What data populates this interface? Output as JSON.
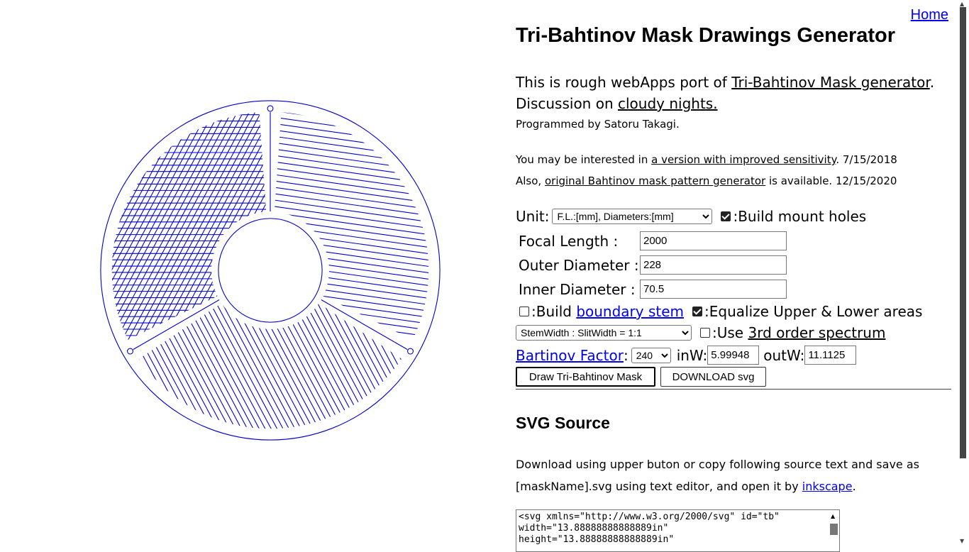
{
  "nav": {
    "home": "Home"
  },
  "title": "Tri-Bahtinov Mask Drawings Generator",
  "intro": {
    "line1_prefix": "This is rough webApps port of ",
    "line1_link": "Tri-Bahtinov Mask generator",
    "line1_suffix": ".",
    "line2_prefix": "Discussion on ",
    "line2_link": "cloudy nights."
  },
  "author": "Programmed by Satoru Takagi.",
  "notes": [
    {
      "prefix": "You may be interested in ",
      "link": "a version with improved sensitivity",
      "suffix": ". 7/15/2018"
    },
    {
      "prefix": "Also, ",
      "link": "original Bahtinov mask pattern generator",
      "suffix": " is available. 12/15/2020"
    }
  ],
  "form": {
    "unit_label": "Unit:",
    "unit_selected": "F.L.:[mm], Diameters:[mm]",
    "mount_holes_label": ":Build mount holes",
    "mount_holes_checked": true,
    "focal_length_label": "Focal Length :",
    "focal_length_value": "2000",
    "outer_diameter_label": "Outer Diameter :",
    "outer_diameter_value": "228",
    "inner_diameter_label": "Inner Diameter :",
    "inner_diameter_value": "70.5",
    "boundary_prefix": ":Build ",
    "boundary_link": "boundary stem",
    "boundary_checked": false,
    "equalize_label": ":Equalize Upper & Lower areas",
    "equalize_checked": true,
    "stem_ratio_selected": "StemWidth : SlitWidth = 1:1",
    "third_order_prefix": ":Use ",
    "third_order_link": "3rd order spectrum",
    "third_order_checked": false,
    "bahtinov_factor_link": "Bartinov Factor",
    "bahtinov_factor_colon": ":",
    "bahtinov_factor_selected": "240",
    "inw_label": "inW:",
    "inw_value": "5.99948",
    "outw_label": "outW:",
    "outw_value": "11.1125",
    "draw_button": "Draw Tri-Bahtinov Mask",
    "download_button": "DOWNLOAD svg"
  },
  "svg_source": {
    "heading": "SVG Source",
    "desc_line1": "Download using upper buton or copy following source text and save as",
    "desc_line2_prefix": "[maskName].svg using text editor, and open it by ",
    "desc_line2_link": "inkscape",
    "desc_line2_suffix": ".",
    "textarea_value": "<svg xmlns=\"http://www.w3.org/2000/svg\" id=\"tb\"\nwidth=\"13.88888888888889in\"\nheight=\"13.88888888888889in\""
  },
  "colors": {
    "mask_stroke": "#0000cc",
    "link": "#0000ee"
  },
  "icons": {
    "checkbox": "checkbox-icon",
    "scroll_up": "scroll-up-icon"
  }
}
